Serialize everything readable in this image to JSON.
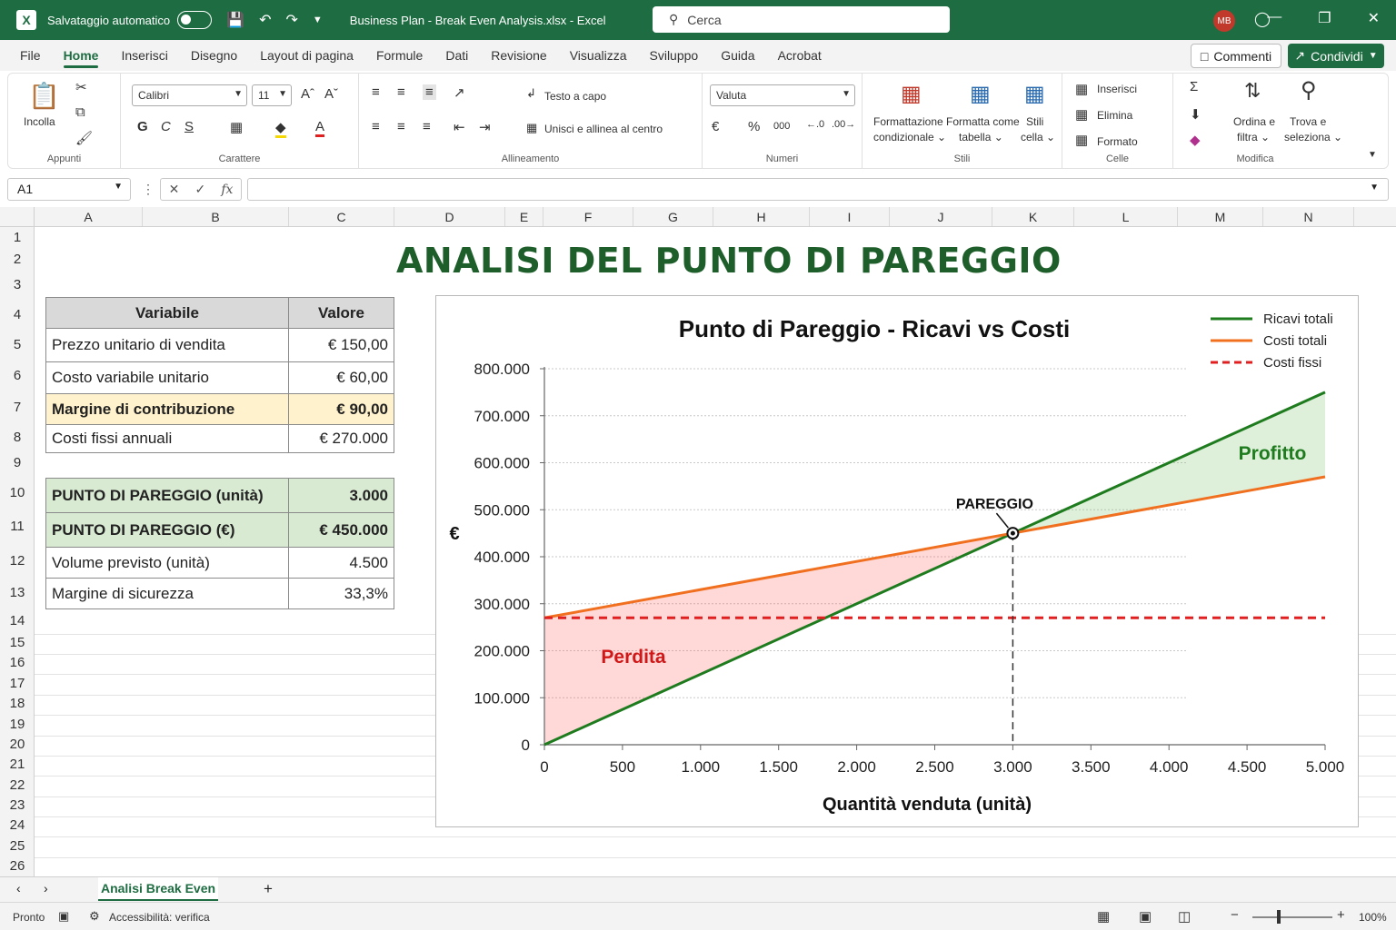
{
  "titlebar": {
    "autosave_label": "Salvataggio automatico",
    "doc_title": "Business Plan - Break Even Analysis.xlsx  -  Excel",
    "search_placeholder": "Cerca",
    "user_initials": "MB"
  },
  "menu": {
    "tabs": [
      "File",
      "Home",
      "Inserisci",
      "Disegno",
      "Layout di pagina",
      "Formule",
      "Dati",
      "Revisione",
      "Visualizza",
      "Sviluppo",
      "Guida",
      "Acrobat"
    ],
    "active": "Home",
    "comments_label": "Commenti",
    "share_label": "Condividi"
  },
  "ribbon": {
    "clipboard": {
      "paste": "Incolla",
      "label": "Appunti"
    },
    "font": {
      "name": "Calibri",
      "size": "11",
      "bold": "G",
      "italic": "C",
      "underline": "S",
      "label": "Carattere"
    },
    "alignment": {
      "wrap": "Testo a capo",
      "merge": "Unisci e allinea al centro",
      "label": "Allineamento"
    },
    "number": {
      "format": "Valuta",
      "currency": "€",
      "percent": "%",
      "thousands": "000",
      "label": "Numeri"
    },
    "styles": {
      "conditional_1": "Formattazione",
      "conditional_2": "condizionale ⌄",
      "table_1": "Formatta come",
      "table_2": "tabella ⌄",
      "cell_1": "Stili",
      "cell_2": "cella ⌄",
      "label": "Stili"
    },
    "cells": {
      "insert": "Inserisci",
      "delete": "Elimina",
      "format": "Formato",
      "label": "Celle"
    },
    "editing": {
      "sort_1": "Ordina e",
      "sort_2": "filtra ⌄",
      "find_1": "Trova e",
      "find_2": "seleziona ⌄",
      "label": "Modifica"
    }
  },
  "formula_bar": {
    "name_box": "A1",
    "formula": ""
  },
  "columns": [
    "A",
    "B",
    "C",
    "D",
    "E",
    "F",
    "G",
    "H",
    "I",
    "J",
    "K",
    "L",
    "M",
    "N"
  ],
  "rows": [
    "1",
    "2",
    "3",
    "4",
    "5",
    "6",
    "7",
    "8",
    "9",
    "10",
    "11",
    "12",
    "13",
    "14",
    "15",
    "16",
    "17",
    "18",
    "19",
    "20",
    "21",
    "22",
    "23",
    "24",
    "25",
    "26"
  ],
  "sheet": {
    "title": "ANALISI DEL PUNTO DI PAREGGIO",
    "table_header": {
      "variable": "Variabile",
      "value": "Valore"
    },
    "inputs": [
      {
        "label": "Prezzo unitario di vendita",
        "value": "€ 150,00"
      },
      {
        "label": "Costo variabile unitario",
        "value": "€  60,00"
      },
      {
        "label": "Margine di contribuzione",
        "value": "€ 90,00"
      },
      {
        "label": "Costi fissi annuali",
        "value": "€ 270.000"
      }
    ],
    "results": [
      {
        "label": "PUNTO DI PAREGGIO (unità)",
        "value": "3.000"
      },
      {
        "label": "PUNTO DI PAREGGIO (€)",
        "value": "€ 450.000"
      },
      {
        "label": "Volume previsto (unità)",
        "value": "4.500"
      },
      {
        "label": "Margine di sicurezza",
        "value": "33,3%"
      }
    ],
    "colors": {
      "title": "#1e5e2a",
      "header_bg": "#d9d9d9",
      "highlight_bg": "#fff2cc",
      "result_bg": "#d9ead3"
    }
  },
  "chart_data": {
    "type": "line",
    "title": "Punto di Pareggio - Ricavi vs Costi",
    "xlabel": "Quantità venduta (unità)",
    "ylabel": "€",
    "x": [
      0,
      5000
    ],
    "x_ticks": [
      "0",
      "500",
      "1.000",
      "1.500",
      "2.000",
      "2.500",
      "3.000",
      "3.500",
      "4.000",
      "4.500",
      "5.000"
    ],
    "y_ticks": [
      "0",
      "100.000",
      "200.000",
      "300.000",
      "400.000",
      "500.000",
      "600.000",
      "700.000",
      "800.000"
    ],
    "xlim": [
      0,
      5000
    ],
    "ylim": [
      0,
      800000
    ],
    "series": [
      {
        "name": "Ricavi totali",
        "x": [
          0,
          5000
        ],
        "values": [
          0,
          750000
        ],
        "color": "#1e7b1e",
        "style": "solid"
      },
      {
        "name": "Costi totali",
        "x": [
          0,
          5000
        ],
        "values": [
          270000,
          570000
        ],
        "color": "#f07020",
        "style": "solid"
      },
      {
        "name": "Costi fissi",
        "x": [
          0,
          5000
        ],
        "values": [
          270000,
          270000
        ],
        "color": "#e02020",
        "style": "dashed"
      }
    ],
    "break_even": {
      "x": 3000,
      "y": 450000,
      "label": "PAREGGIO"
    },
    "annotations": {
      "loss": "Perdita",
      "profit": "Profitto"
    },
    "legend": "top-right",
    "grid": true
  },
  "sheet_tabs": {
    "active": "Analisi Break Even"
  },
  "status": {
    "ready": "Pronto",
    "accessibility": "Accessibilità: verifica",
    "zoom": "100%"
  }
}
